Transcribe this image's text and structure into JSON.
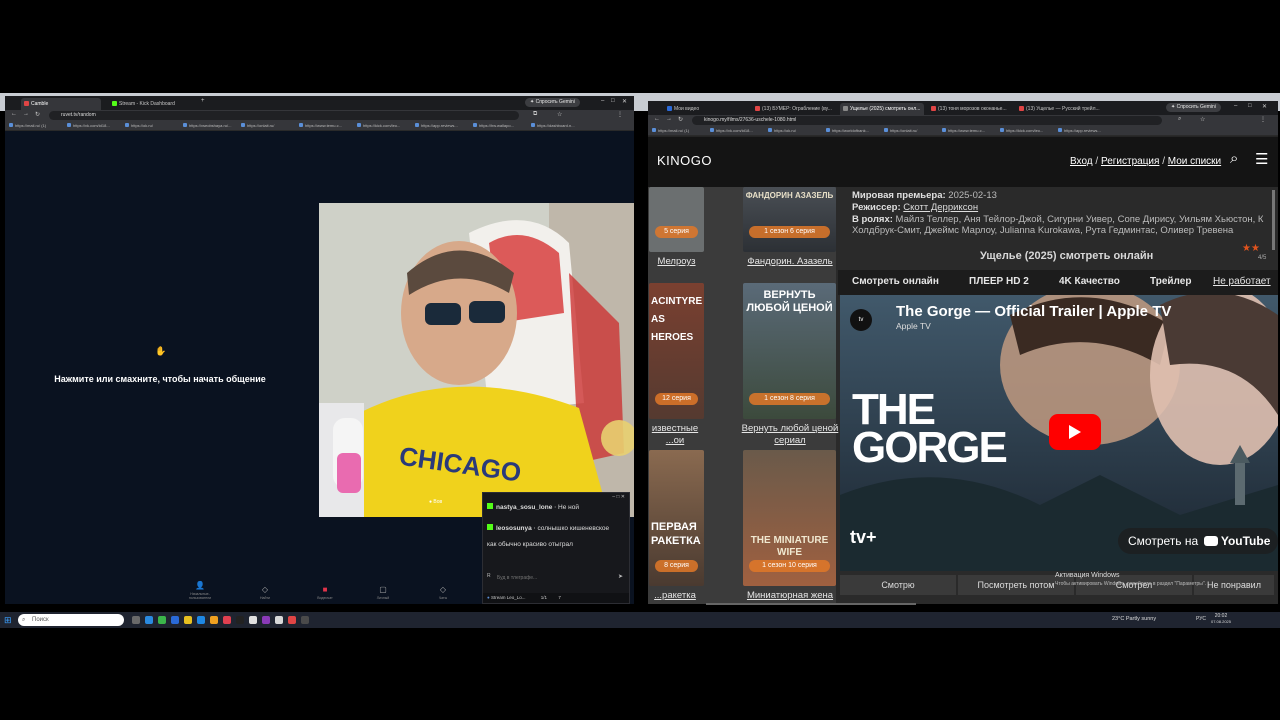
{
  "left_browser": {
    "tabs": [
      {
        "label": "Camble",
        "color": "#e04545",
        "active": true
      },
      {
        "label": "Stream - Kick Dashboard",
        "color": "#53fc18",
        "active": false
      }
    ],
    "gemini": "Спросить Gemini",
    "url": "ruvet.tv/random",
    "bookmarks": [
      "https://mail.ru/ (1)",
      "https://vk.com/id18...",
      "https://ok.ru/",
      "https://vseobshaya.ru/...",
      "https://onlait.ru/",
      "https://www.temu.c...",
      "https://kick.com/leo...",
      "https://app.reviews...",
      "https://hw.wallapo...",
      "https://dashboard.n..."
    ]
  },
  "video_chat": {
    "prompt": "Нажмите или смахните, чтобы начать общение",
    "webcam_label": "Вов",
    "nav": [
      "Начальные-пользователи",
      "Найти",
      "Видеочат",
      "Личный",
      "Чаты"
    ]
  },
  "chat_window": {
    "messages": [
      {
        "user": "nastya_sosu_lone",
        "text": "Не ной"
      },
      {
        "user": "leososunya",
        "text": "солнышко кишеневское как обычно красиво отыграл"
      }
    ],
    "input_placeholder": "Буд в тлеграфе...",
    "stream_title": "Stream Leo_Lo...",
    "viewers": "1/1",
    "count": "7"
  },
  "right_browser": {
    "tabs": [
      {
        "label": "Мои видео",
        "color": "#2b6ad8",
        "active": false
      },
      {
        "label": "(13) БУМЕР: Ограбление (ву...",
        "color": "#e04545",
        "active": false
      },
      {
        "label": "Ущелье (2025) смотреть онл...",
        "color": "#888888",
        "active": true
      },
      {
        "label": "(13) тоня морозов оконанье...",
        "color": "#e04545",
        "active": false
      },
      {
        "label": "(13) Ущелье — Русский трейл...",
        "color": "#e04545",
        "active": false
      }
    ],
    "gemini": "Спросить Gemini",
    "url": "kinogo.my/films/27636-uschele-1080.html",
    "bookmarks": [
      "https://mail.ru/ (1)",
      "https://vk.com/id18...",
      "https://ok.ru/",
      "https://worldofbank...",
      "https://onlait.ru/",
      "https://www.temu.c...",
      "https://kick.com/leo...",
      "https://app.reviews..."
    ]
  },
  "kinogo": {
    "logo": "KINOGO",
    "login": "Вход",
    "sep": "/",
    "register": "Регистрация",
    "lists": "Мои списки",
    "posters": [
      {
        "title": "Мелроуз",
        "badge": "5 серия"
      },
      {
        "title": "Фандорин. Азазель",
        "badge": "1 сезон 6 серия",
        "art": "ФАНДОРИН АЗАЗЕЛЬ"
      },
      {
        "title": "известные ...ои",
        "badge": "12 серия",
        "art": "ACINTYRE AS HEROES"
      },
      {
        "title": "Вернуть любой ценой сериал",
        "badge": "1 сезон 8 серия",
        "art": "ВЕРНУТЬ ЛЮБОЙ ЦЕНОЙ"
      },
      {
        "title": "...ракетка",
        "badge": "8 серия",
        "art": "ПЕРВАЯ РАКЕТКА"
      },
      {
        "title": "Миниатюрная жена",
        "badge": "1 сезон 10 серия",
        "art": "THE MINIATURE WIFE"
      }
    ],
    "info": {
      "premiere_label": "Мировая премьера:",
      "premiere": "2025-02-13",
      "director_label": "Режиссер:",
      "director": "Скотт Дерриксон",
      "cast_label": "В ролях:",
      "cast_line1": "Майлз Теллер, Аня Тейлор-Джой, Сигурни Уивер, Сопе Дирису, Уильям Хьюстон, К",
      "cast_line2": "Холдбрук-Смит, Джеймс Марлоу, Julianna Kurokawa, Рута Гедминтас, Оливер Тревена"
    },
    "watch_title": "Ущелье (2025) смотреть онлайн",
    "rating": "4/5",
    "rating_stars": 2,
    "player_tabs": [
      "Смотреть онлайн",
      "ПЛЕЕР HD 2",
      "4K Качество",
      "Трейлер",
      "Не работает"
    ],
    "trailer": {
      "title": "The Gorge — Official Trailer | Apple TV",
      "channel": "Apple TV",
      "art_title": "THE GORGE",
      "watch_on": "Смотреть на",
      "youtube": "YouTube",
      "appletv": "tv+"
    },
    "bottom_buttons": [
      "Смотрю",
      "Посмотреть потом",
      "Смотрел",
      "Не понравил"
    ],
    "activation_line1": "Активация Windows",
    "activation_line2": "Чтобы активировать Windows, перейдите в раздел \"Параметры\"."
  },
  "taskbar": {
    "search_placeholder": "Поиск",
    "weather": "23°C Partly sunny",
    "lang": "РУС",
    "time": "20:02",
    "date": "07.08.2025"
  }
}
